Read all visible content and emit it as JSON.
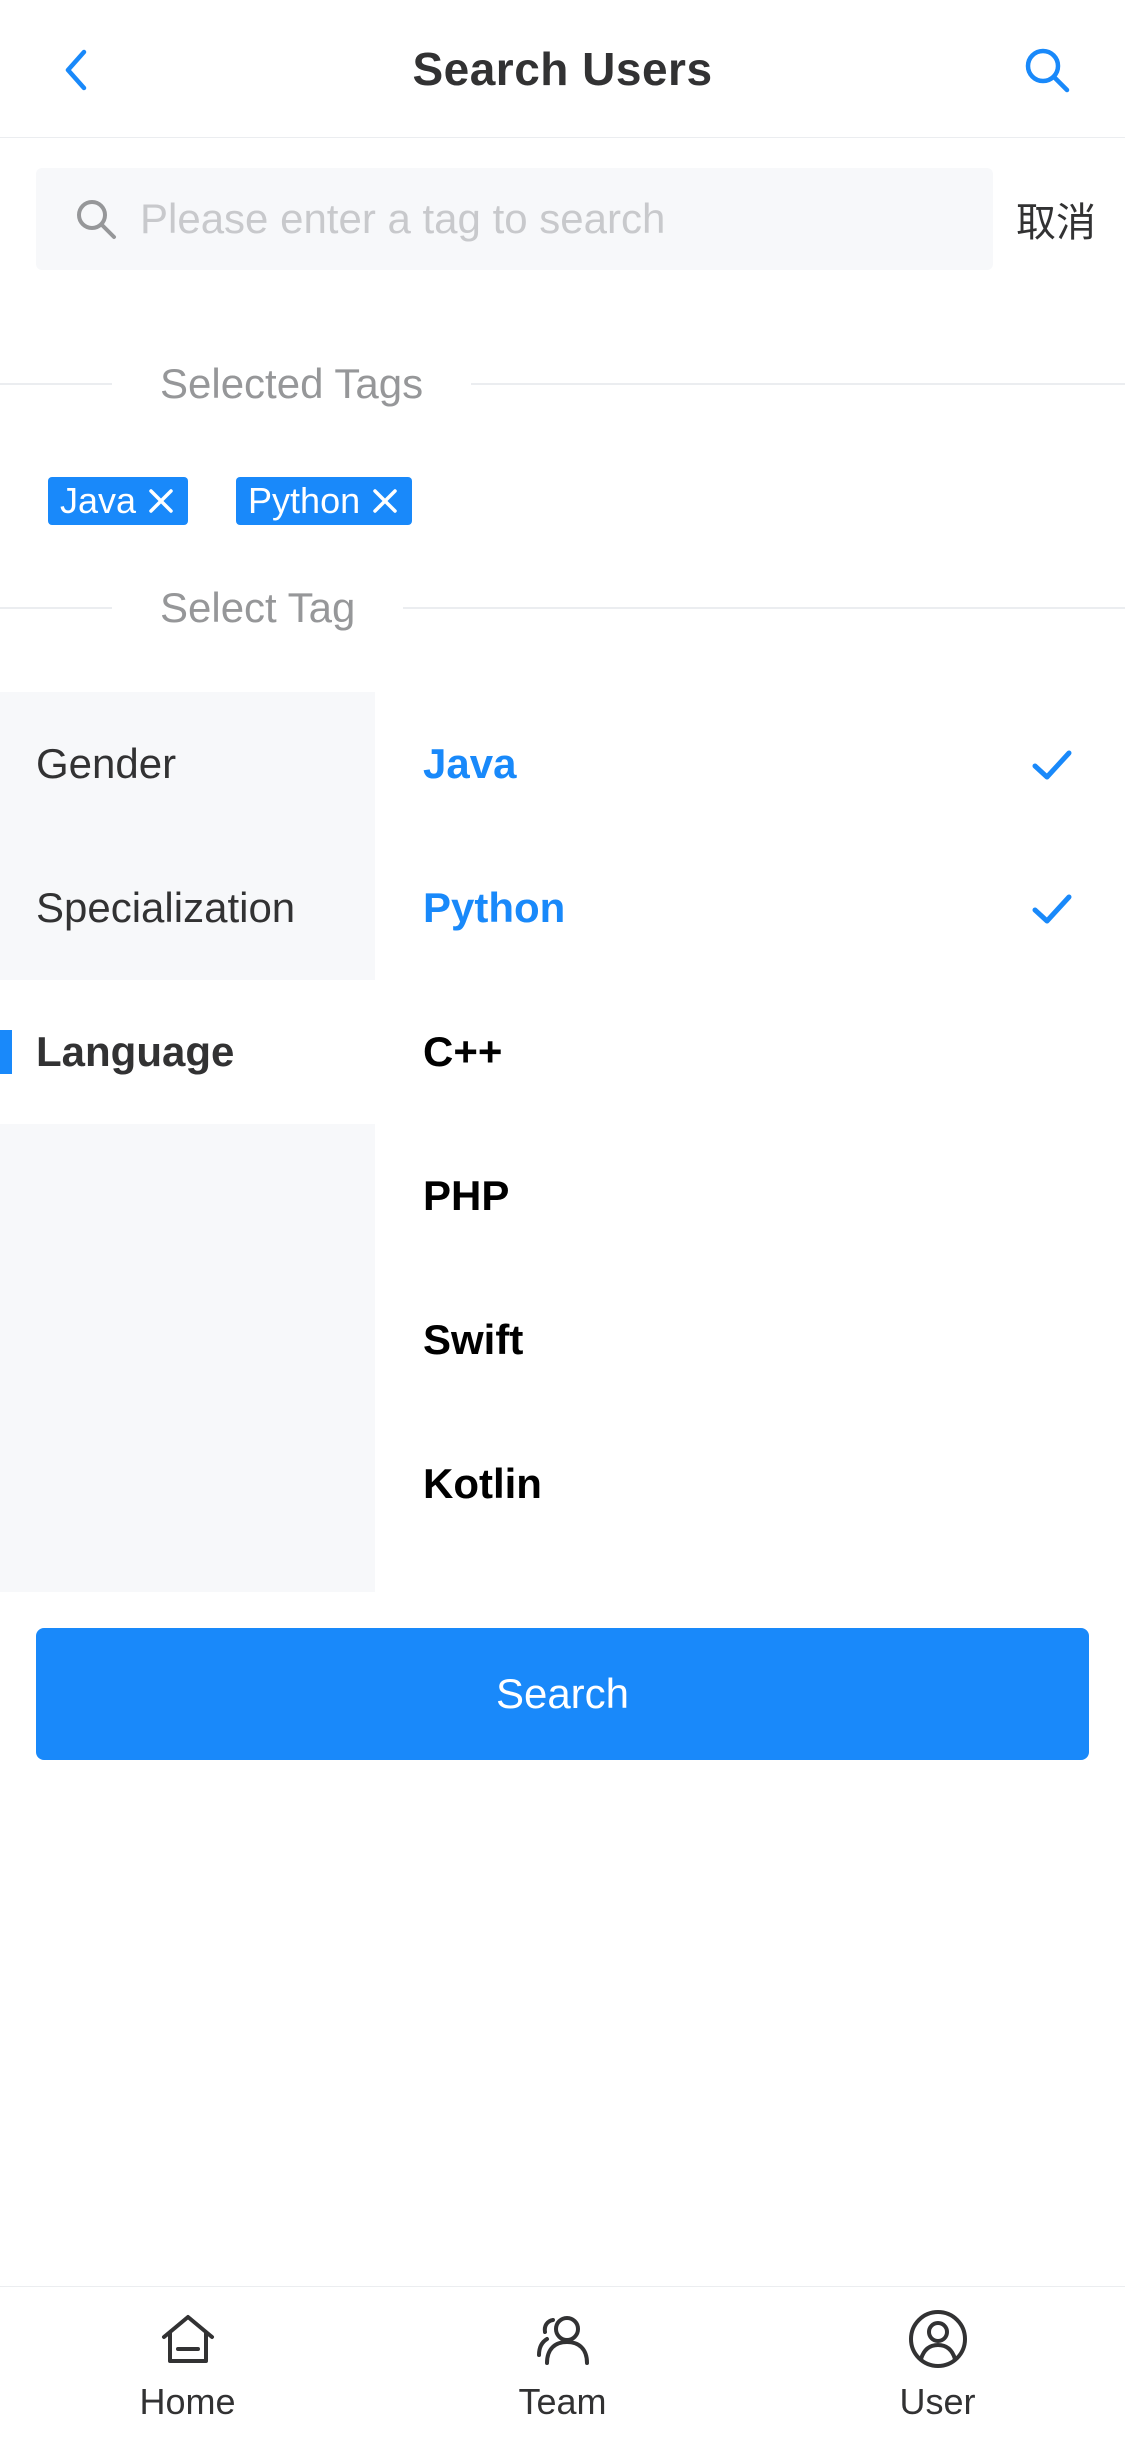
{
  "navbar": {
    "title": "Search Users",
    "back_icon": "chevron-left-icon",
    "search_icon": "search-icon"
  },
  "search": {
    "placeholder": "Please enter a tag to search",
    "value": "",
    "cancel_label": "取消"
  },
  "selected_section": {
    "title": "Selected Tags",
    "tags": [
      {
        "label": "Java"
      },
      {
        "label": "Python"
      }
    ]
  },
  "select_section": {
    "title": "Select Tag"
  },
  "tree": {
    "categories": [
      {
        "label": "Gender",
        "active": false
      },
      {
        "label": "Specialization",
        "active": false
      },
      {
        "label": "Language",
        "active": true
      }
    ],
    "options": [
      {
        "label": "Java",
        "selected": true
      },
      {
        "label": "Python",
        "selected": true
      },
      {
        "label": "C++",
        "selected": false
      },
      {
        "label": "PHP",
        "selected": false
      },
      {
        "label": "Swift",
        "selected": false
      },
      {
        "label": "Kotlin",
        "selected": false
      }
    ]
  },
  "search_button": {
    "label": "Search"
  },
  "tabbar": {
    "items": [
      {
        "label": "Home",
        "icon": "home-icon"
      },
      {
        "label": "Team",
        "icon": "team-icon"
      },
      {
        "label": "User",
        "icon": "user-icon"
      }
    ]
  },
  "colors": {
    "accent": "#1989fa",
    "text": "#323233",
    "muted": "#969799",
    "panel": "#f7f8fa"
  }
}
